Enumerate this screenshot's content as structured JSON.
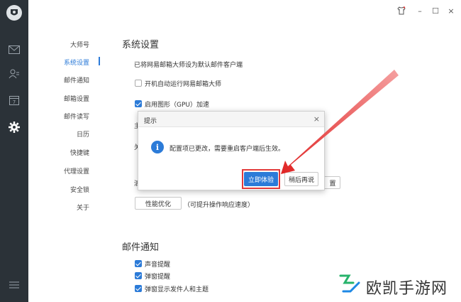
{
  "window": {
    "skin_icon": "tshirt-icon",
    "minimize": "–",
    "maximize": "☐",
    "close": "×"
  },
  "rail": {
    "icons": [
      "mail-icon",
      "contacts-icon",
      "calendar-icon",
      "settings-icon",
      "menu-icon"
    ],
    "calendar_day": "7"
  },
  "nav": {
    "items": [
      "大师号",
      "系统设置",
      "邮件通知",
      "邮箱设置",
      "邮件读写",
      "日历",
      "快捷键",
      "代理设置",
      "安全锁",
      "关于"
    ],
    "active": "系统设置"
  },
  "system": {
    "title": "系统设置",
    "default_client_text": "已将网易邮箱大师设为默认邮件客户端",
    "autostart_label": "开机自动运行网易邮箱大师",
    "autostart_checked": false,
    "gpu_label": "启用图形（GPU）加速",
    "gpu_checked": true,
    "perf_button": "性能优化",
    "perf_hint": "（可提升操作响应速度）",
    "partial_row1": "主",
    "partial_row2": "关",
    "partial_row3": "清",
    "partial_button": "置"
  },
  "notify": {
    "title": "邮件通知",
    "items": [
      {
        "label": "声音提醒",
        "checked": true
      },
      {
        "label": "弹窗提醒",
        "checked": true
      },
      {
        "label": "弹窗显示发件人和主题",
        "checked": true
      }
    ]
  },
  "dialog": {
    "title": "提示",
    "close": "×",
    "info_glyph": "i",
    "message": "配置项已更改，需要重启客户端后生效。",
    "primary": "立即体验",
    "secondary": "稍后再说"
  },
  "watermark": {
    "text": "欧凯手游网"
  },
  "colors": {
    "accent": "#2c7bd8",
    "annotation": "#e23a3a",
    "rail": "#2b3238",
    "watermark_green": "#27b36b"
  }
}
